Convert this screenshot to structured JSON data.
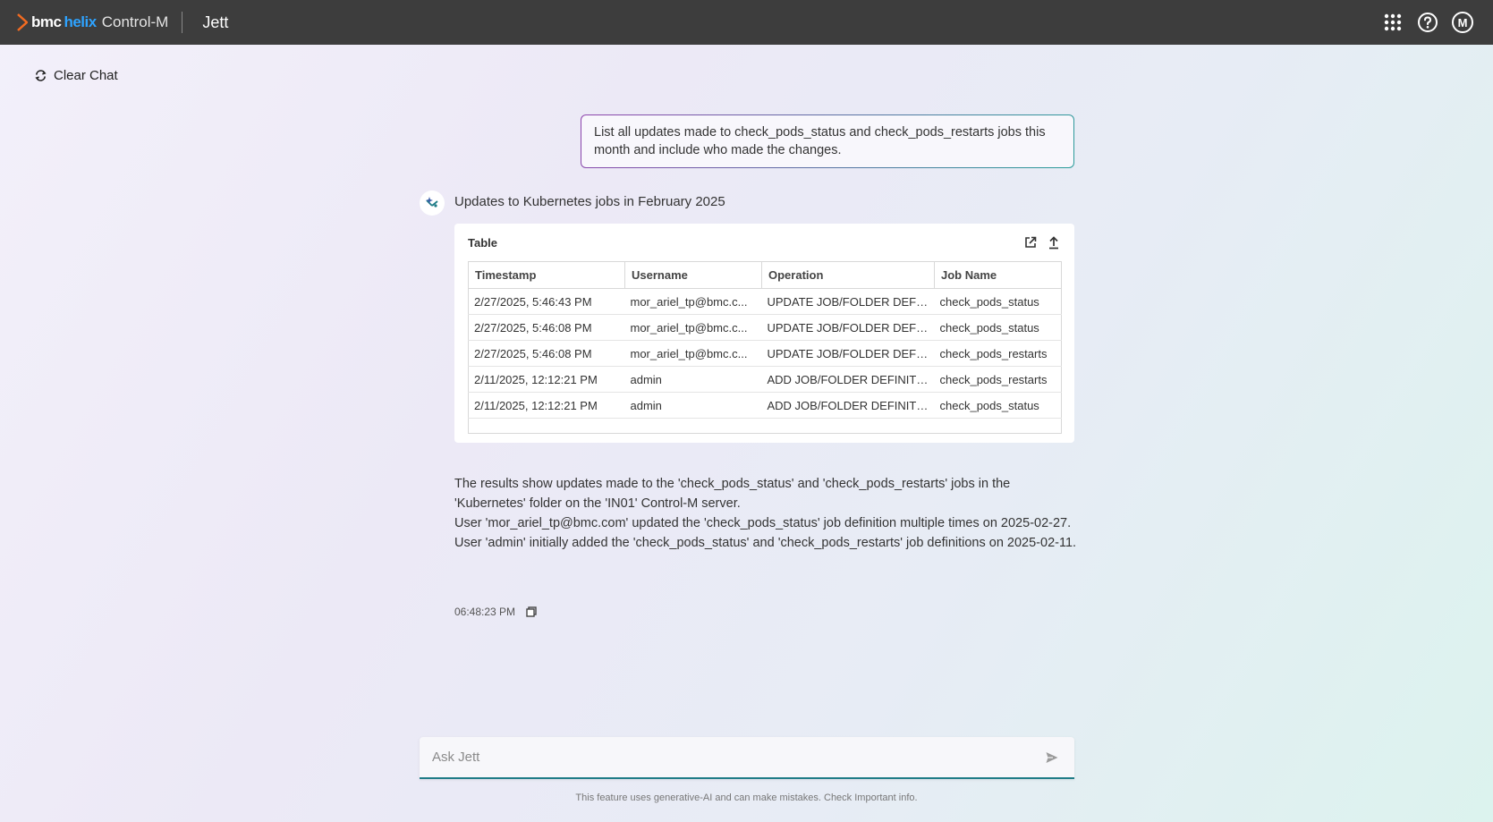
{
  "header": {
    "brand_bmc": "bmc",
    "brand_helix": "helix",
    "brand_product": "Control-M",
    "app_name": "Jett",
    "avatar_initial": "M"
  },
  "toolbar": {
    "clear_chat_label": "Clear Chat"
  },
  "user_message": {
    "text": "List all updates made to check_pods_status and check_pods_restarts jobs this month and include who made the changes."
  },
  "response": {
    "heading": "Updates to Kubernetes jobs in February 2025",
    "table_title": "Table",
    "columns": [
      "Timestamp",
      "Username",
      "Operation",
      "Job Name"
    ],
    "rows": [
      [
        "2/27/2025, 5:46:43 PM",
        "mor_ariel_tp@bmc.c...",
        "UPDATE JOB/FOLDER DEFIN...",
        "check_pods_status"
      ],
      [
        "2/27/2025, 5:46:08 PM",
        "mor_ariel_tp@bmc.c...",
        "UPDATE JOB/FOLDER DEFIN...",
        "check_pods_status"
      ],
      [
        "2/27/2025, 5:46:08 PM",
        "mor_ariel_tp@bmc.c...",
        "UPDATE JOB/FOLDER DEFIN...",
        "check_pods_restarts"
      ],
      [
        "2/11/2025, 12:12:21 PM",
        "admin",
        "ADD JOB/FOLDER DEFINITION",
        "check_pods_restarts"
      ],
      [
        "2/11/2025, 12:12:21 PM",
        "admin",
        "ADD JOB/FOLDER DEFINITION",
        "check_pods_status"
      ]
    ],
    "summary": [
      "The results show updates made to the 'check_pods_status' and 'check_pods_restarts' jobs in the 'Kubernetes' folder on the 'IN01' Control-M server.",
      "User 'mor_ariel_tp@bmc.com' updated the 'check_pods_status' job definition multiple times on 2025-02-27.",
      "User 'admin' initially added the 'check_pods_status' and 'check_pods_restarts' job definitions on 2025-02-11."
    ],
    "timestamp": "06:48:23 PM"
  },
  "input": {
    "placeholder": "Ask Jett",
    "value": ""
  },
  "footer": {
    "disclaimer": "This feature uses generative-AI and can make mistakes. Check Important info."
  },
  "colors": {
    "topbar": "#3d3d3d",
    "helix_blue": "#2ea3ff",
    "bmc_orange": "#f26b21",
    "input_accent": "#1f7c87"
  },
  "icons": {
    "logo": "bmc-chevron-logo",
    "apps": "apps-grid-icon",
    "help": "help-icon",
    "clear": "refresh-icon",
    "open": "open-external-icon",
    "export": "export-icon",
    "copy": "copy-icon",
    "send": "send-icon",
    "bot": "jett-bot-icon"
  }
}
